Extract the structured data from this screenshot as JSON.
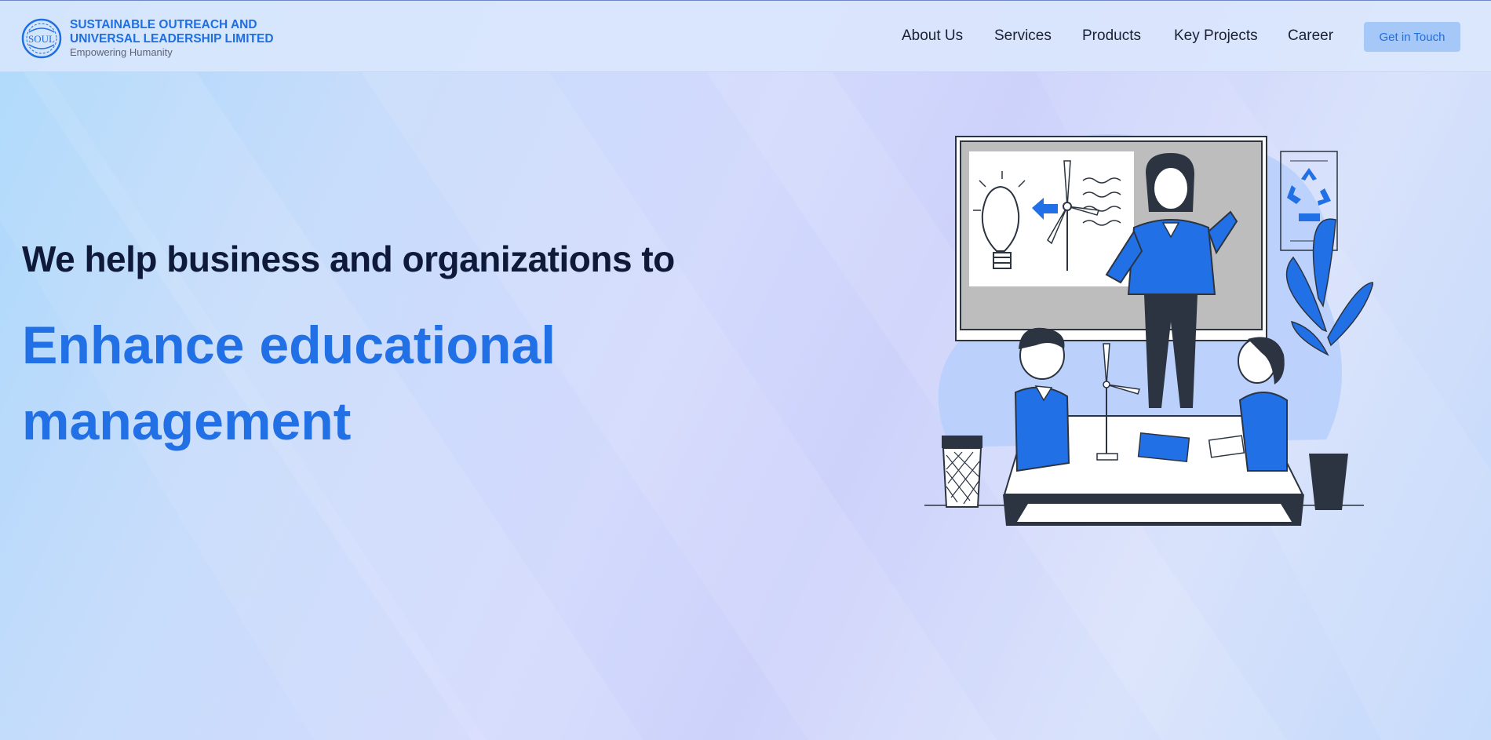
{
  "brand": {
    "name": "SUSTAINABLE OUTREACH AND UNIVERSAL LEADERSHIP LIMITED",
    "tagline": "Empowering Humanity",
    "logo_text": "SOUL",
    "logo_icon": "globe-emblem-icon"
  },
  "nav": {
    "items": [
      {
        "label": "About Us"
      },
      {
        "label": "Services"
      },
      {
        "label": "Products"
      },
      {
        "label": "Key Projects"
      },
      {
        "label": "Career"
      }
    ],
    "cta_label": "Get in Touch"
  },
  "hero": {
    "intro": "We help business and organizations to",
    "highlight": "Enhance educational management"
  },
  "illustration": {
    "subject": "classroom-illustration",
    "icons": [
      "lightbulb-icon",
      "wind-turbine-icon",
      "recycle-icon",
      "plant-icon",
      "trash-bin-icon"
    ]
  },
  "colors": {
    "accent": "#2170e6",
    "heading": "#0f1a3a",
    "nav_text": "#1b2033",
    "cta_bg": "#a6c8f9",
    "header_bg": "#dce8fc"
  }
}
